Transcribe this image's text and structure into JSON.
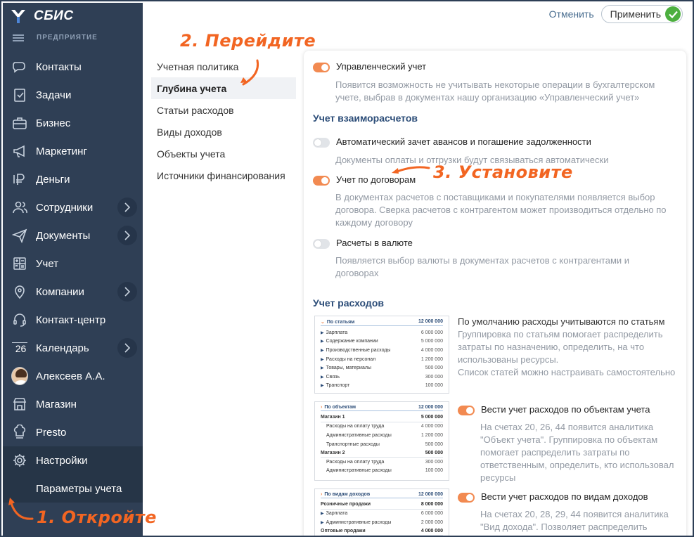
{
  "app": {
    "name": "СБИС",
    "org_label": "ПРЕДПРИЯТИЕ"
  },
  "colors": {
    "sidebar": "#2f3f55",
    "accent": "#f28a51",
    "heading": "#2c4d78",
    "success": "#4caf3f",
    "annotation": "#f26522"
  },
  "nav": {
    "items": [
      {
        "label": "Контакты",
        "icon": "chat-icon"
      },
      {
        "label": "Задачи",
        "icon": "tasks-icon"
      },
      {
        "label": "Бизнес",
        "icon": "business-icon"
      },
      {
        "label": "Маркетинг",
        "icon": "megaphone-icon"
      },
      {
        "label": "Деньги",
        "icon": "ruble-icon"
      },
      {
        "label": "Сотрудники",
        "icon": "employees-icon",
        "has_arrow": true
      },
      {
        "label": "Документы",
        "icon": "send-icon",
        "has_arrow": true
      },
      {
        "label": "Учет",
        "icon": "calculator-icon"
      },
      {
        "label": "Компании",
        "icon": "location-icon",
        "has_arrow": true
      },
      {
        "label": "Контакт-центр",
        "icon": "headset-icon"
      },
      {
        "label": "Календарь",
        "icon": "calendar-icon",
        "calendar_day": "26",
        "has_arrow": true
      },
      {
        "label": "Алексеев А.А.",
        "icon": "avatar"
      },
      {
        "label": "Магазин",
        "icon": "shop-icon"
      },
      {
        "label": "Presto",
        "icon": "chef-icon"
      },
      {
        "label": "Настройки",
        "icon": "gear-icon",
        "active": true
      }
    ],
    "sub_item": "Параметры учета"
  },
  "topbar": {
    "cancel": "Отменить",
    "apply": "Применить"
  },
  "sections": [
    {
      "label": "Учетная политика",
      "active": false
    },
    {
      "label": "Глубина учета",
      "active": true
    },
    {
      "label": "Статьи расходов",
      "active": false
    },
    {
      "label": "Виды доходов",
      "active": false
    },
    {
      "label": "Объекты учета",
      "active": false
    },
    {
      "label": "Источники финансирования",
      "active": false
    }
  ],
  "content": {
    "mgmt": {
      "title": "Управленческий учет",
      "on": true,
      "desc1": "Появится возможность не учитывать некоторые операции в бухгалтерском",
      "desc2": "учете, выбрав в документах нашу организацию «Управленческий учет»"
    },
    "settlements_heading": "Учет взаиморасчетов",
    "auto_offset": {
      "title": "Автоматический зачет авансов и погашение задолженности",
      "on": false,
      "desc1": "Документы оплаты и отгрузки будут связываться автоматически"
    },
    "contracts": {
      "title": "Учет по договорам",
      "on": true,
      "desc1": "В документах расчетов с поставщиками и покупателями появляется выбор",
      "desc2": "договора. Сверка расчетов с контрагентом может производиться отдельно по",
      "desc3": "каждому договору"
    },
    "currency": {
      "title": "Расчеты в валюте",
      "on": false,
      "desc1": "Появляется выбор валюты в документах расчетов с контрагентами и",
      "desc2": "договорах"
    },
    "expenses_heading": "Учет расходов",
    "expenses_text": {
      "l1": "По умолчанию расходы учитываются по статьям",
      "l2": "Группировка по статьям помогает распределить",
      "l3": "затраты по назначению, определить, на что",
      "l4": "использованы ресурсы.",
      "l5": "Список статей можно настраивать самостоятельно"
    },
    "thumb1": {
      "head": "По статьям",
      "head_value": "12 000 000",
      "rows": [
        {
          "label": "Зарплата",
          "value": "6 000 000"
        },
        {
          "label": "Содержание компании",
          "value": "5 000 000"
        },
        {
          "label": "Производственные расходы",
          "value": "4 000 000"
        },
        {
          "label": "Расходы на персонал",
          "value": "1 200 000"
        },
        {
          "label": "Товары, материалы",
          "value": "500 000"
        },
        {
          "label": "Связь",
          "value": "300 000"
        },
        {
          "label": "Транспорт",
          "value": "100 000"
        }
      ]
    },
    "thumb2": {
      "head": "По объектам",
      "head_value": "12 000 000",
      "rows": [
        {
          "label": "Магазин 1",
          "value": "5 000 000",
          "group": true
        },
        {
          "label": "Расходы на оплату труда",
          "value": "4 000 000"
        },
        {
          "label": "Административные расходы",
          "value": "1 200 000"
        },
        {
          "label": "Транспортные расходы",
          "value": "500 000"
        },
        {
          "label": "Магазин 2",
          "value": "500 000",
          "group": true
        },
        {
          "label": "Расходы на оплату труда",
          "value": "300 000"
        },
        {
          "label": "Административные расходы",
          "value": "100 000"
        }
      ]
    },
    "thumb3": {
      "head": "По видам доходов",
      "head_value": "12 000 000",
      "rows": [
        {
          "label": "Розничные продажи",
          "value": "8 000 000",
          "group": true
        },
        {
          "label": "Зарплата",
          "value": "6 000 000"
        },
        {
          "label": "Административные расходы",
          "value": "2 000 000"
        },
        {
          "label": "Оптовые продажи",
          "value": "4 000 000",
          "group": true
        }
      ]
    },
    "by_objects": {
      "title": "Вести учет расходов по объектам учета",
      "on": true,
      "desc1": "На счетах 20, 26, 44 появится аналитика",
      "desc2": "\"Объект учета\". Группировка по объектам",
      "desc3": "помогает распределить затраты по",
      "desc4": "ответственным, определить, кто использовал",
      "desc5": "ресурсы"
    },
    "by_income": {
      "title": "Вести учет расходов по видам доходов",
      "on": true,
      "desc1": "На счетах 20, 28, 29, 44 появится аналитика",
      "desc2": "\"Вид дохода\". Позволяет распределить"
    }
  },
  "annotations": {
    "step1": "1. Откройте",
    "step2": "2. Перейдите",
    "step3": "3. Установите"
  }
}
